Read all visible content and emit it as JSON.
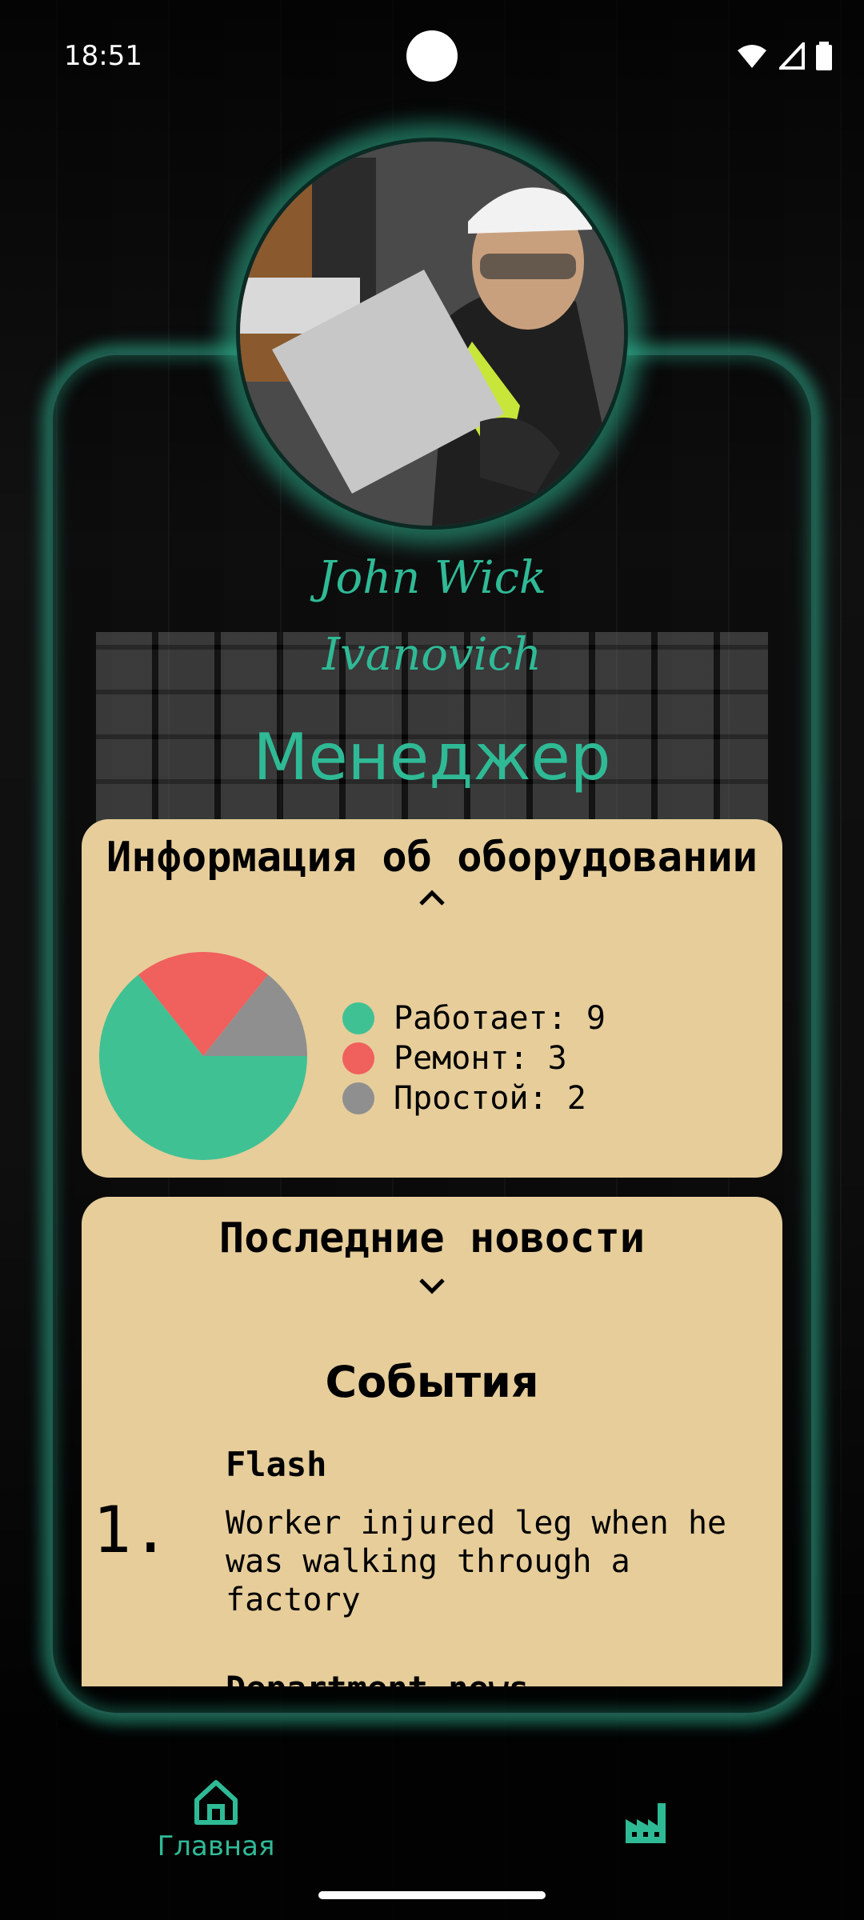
{
  "status_bar": {
    "time": "18:51"
  },
  "profile": {
    "name_line1": "John  Wick",
    "name_line2": "Ivanovich",
    "role": "Менеджер"
  },
  "equipment": {
    "title": "Информация об оборудовании",
    "legend": [
      {
        "label": "Работает: 9",
        "color": "#3fc194"
      },
      {
        "label": "Ремонт: 3",
        "color": "#f0605d"
      },
      {
        "label": "Простой: 2",
        "color": "#8f8f8f"
      }
    ]
  },
  "chart_data": {
    "type": "pie",
    "categories": [
      "Работает",
      "Ремонт",
      "Простой"
    ],
    "values": [
      9,
      3,
      2
    ],
    "colors": [
      "#3fc194",
      "#f0605d",
      "#8f8f8f"
    ]
  },
  "news": {
    "title": "Последние новости",
    "section_title": "События",
    "items": [
      {
        "number": "1.",
        "heading": "Flash",
        "text": "Worker injured leg when he was walking through a factory"
      },
      {
        "heading": "Department news"
      }
    ]
  },
  "bottom_nav": {
    "home_label": "Главная"
  },
  "colors": {
    "accent": "#2fba96",
    "panel": "#e6cd9a"
  }
}
